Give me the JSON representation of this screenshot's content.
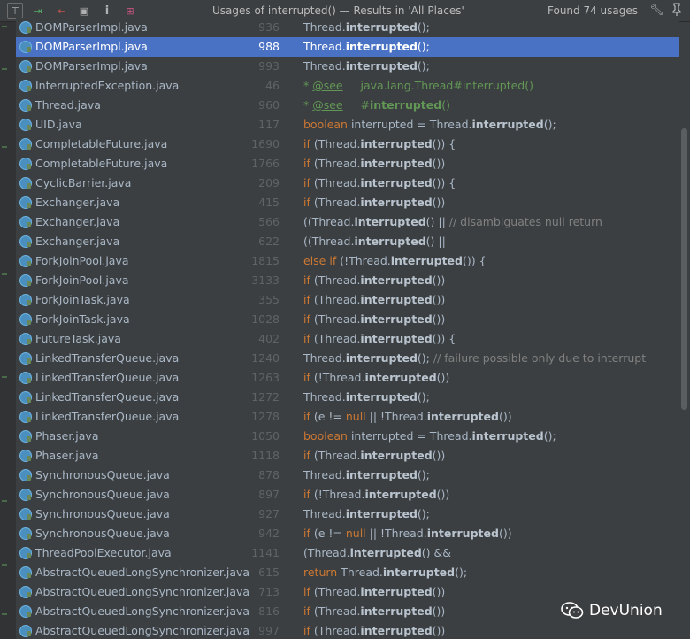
{
  "toolbar": {
    "title": "Usages of interrupted() — Results in 'All Places'",
    "count": "Found 74 usages",
    "buttons": [
      {
        "name": "merge-icon",
        "glyph": "⊤"
      },
      {
        "name": "jump-in-icon",
        "glyph": "⇥"
      },
      {
        "name": "jump-out-icon",
        "glyph": "⇤"
      },
      {
        "name": "folder-icon",
        "glyph": "▣"
      },
      {
        "name": "info-icon",
        "glyph": "i"
      },
      {
        "name": "expand-icon",
        "glyph": "⊞"
      }
    ]
  },
  "rows": [
    {
      "file": "DOMParserImpl.java",
      "line": "936",
      "code": [
        {
          "t": "Thread."
        },
        {
          "t": "interrupted",
          "b": true
        },
        {
          "t": "();"
        }
      ]
    },
    {
      "file": "DOMParserImpl.java",
      "line": "988",
      "selected": true,
      "code": [
        {
          "t": "Thread."
        },
        {
          "t": "interrupted",
          "b": true
        },
        {
          "t": "();"
        }
      ]
    },
    {
      "file": "DOMParserImpl.java",
      "line": "993",
      "code": [
        {
          "t": "Thread."
        },
        {
          "t": "interrupted",
          "b": true
        },
        {
          "t": "();"
        }
      ]
    },
    {
      "file": "InterruptedException.java",
      "line": "46",
      "code": [
        {
          "t": "* ",
          "c": "doc"
        },
        {
          "t": "@see",
          "c": "tag"
        },
        {
          "t": "     java.lang.Thread#interrupted()",
          "c": "doc"
        }
      ]
    },
    {
      "file": "Thread.java",
      "line": "960",
      "code": [
        {
          "t": "* ",
          "c": "doc"
        },
        {
          "t": "@see",
          "c": "tag"
        },
        {
          "t": "     #",
          "c": "doc"
        },
        {
          "t": "interrupted",
          "c": "doc",
          "b": true
        },
        {
          "t": "()",
          "c": "doc"
        }
      ]
    },
    {
      "file": "UID.java",
      "line": "117",
      "code": [
        {
          "t": "boolean ",
          "c": "kw"
        },
        {
          "t": "interrupted = Thread."
        },
        {
          "t": "interrupted",
          "b": true
        },
        {
          "t": "();"
        }
      ]
    },
    {
      "file": "CompletableFuture.java",
      "line": "1690",
      "code": [
        {
          "t": "if ",
          "c": "kw"
        },
        {
          "t": "(Thread."
        },
        {
          "t": "interrupted",
          "b": true
        },
        {
          "t": "()) {"
        }
      ]
    },
    {
      "file": "CompletableFuture.java",
      "line": "1766",
      "code": [
        {
          "t": "if ",
          "c": "kw"
        },
        {
          "t": "(Thread."
        },
        {
          "t": "interrupted",
          "b": true
        },
        {
          "t": "())"
        }
      ]
    },
    {
      "file": "CyclicBarrier.java",
      "line": "209",
      "code": [
        {
          "t": "if ",
          "c": "kw"
        },
        {
          "t": "(Thread."
        },
        {
          "t": "interrupted",
          "b": true
        },
        {
          "t": "()) {"
        }
      ]
    },
    {
      "file": "Exchanger.java",
      "line": "415",
      "code": [
        {
          "t": "if ",
          "c": "kw"
        },
        {
          "t": "(Thread."
        },
        {
          "t": "interrupted",
          "b": true
        },
        {
          "t": "())"
        }
      ]
    },
    {
      "file": "Exchanger.java",
      "line": "566",
      "code": [
        {
          "t": "((Thread."
        },
        {
          "t": "interrupted",
          "b": true
        },
        {
          "t": "() || "
        },
        {
          "t": "// disambiguates null return",
          "c": "cm"
        }
      ]
    },
    {
      "file": "Exchanger.java",
      "line": "622",
      "code": [
        {
          "t": "((Thread."
        },
        {
          "t": "interrupted",
          "b": true
        },
        {
          "t": "() ||"
        }
      ]
    },
    {
      "file": "ForkJoinPool.java",
      "line": "1815",
      "code": [
        {
          "t": "else if ",
          "c": "kw"
        },
        {
          "t": "(!Thread."
        },
        {
          "t": "interrupted",
          "b": true
        },
        {
          "t": "()) {"
        }
      ]
    },
    {
      "file": "ForkJoinPool.java",
      "line": "3133",
      "code": [
        {
          "t": "if ",
          "c": "kw"
        },
        {
          "t": "(Thread."
        },
        {
          "t": "interrupted",
          "b": true
        },
        {
          "t": "())"
        }
      ]
    },
    {
      "file": "ForkJoinTask.java",
      "line": "355",
      "code": [
        {
          "t": "if ",
          "c": "kw"
        },
        {
          "t": "(Thread."
        },
        {
          "t": "interrupted",
          "b": true
        },
        {
          "t": "())"
        }
      ]
    },
    {
      "file": "ForkJoinTask.java",
      "line": "1028",
      "code": [
        {
          "t": "if ",
          "c": "kw"
        },
        {
          "t": "(Thread."
        },
        {
          "t": "interrupted",
          "b": true
        },
        {
          "t": "())"
        }
      ]
    },
    {
      "file": "FutureTask.java",
      "line": "402",
      "code": [
        {
          "t": "if ",
          "c": "kw"
        },
        {
          "t": "(Thread."
        },
        {
          "t": "interrupted",
          "b": true
        },
        {
          "t": "()) {"
        }
      ]
    },
    {
      "file": "LinkedTransferQueue.java",
      "line": "1240",
      "code": [
        {
          "t": "Thread."
        },
        {
          "t": "interrupted",
          "b": true
        },
        {
          "t": "(); "
        },
        {
          "t": "// failure possible only due to interrupt",
          "c": "cm"
        }
      ]
    },
    {
      "file": "LinkedTransferQueue.java",
      "line": "1263",
      "code": [
        {
          "t": "if ",
          "c": "kw"
        },
        {
          "t": "(!Thread."
        },
        {
          "t": "interrupted",
          "b": true
        },
        {
          "t": "())"
        }
      ]
    },
    {
      "file": "LinkedTransferQueue.java",
      "line": "1272",
      "code": [
        {
          "t": "Thread."
        },
        {
          "t": "interrupted",
          "b": true
        },
        {
          "t": "();"
        }
      ]
    },
    {
      "file": "LinkedTransferQueue.java",
      "line": "1278",
      "code": [
        {
          "t": "if ",
          "c": "kw"
        },
        {
          "t": "(e != "
        },
        {
          "t": "null",
          "c": "kw"
        },
        {
          "t": " || !Thread."
        },
        {
          "t": "interrupted",
          "b": true
        },
        {
          "t": "())"
        }
      ]
    },
    {
      "file": "Phaser.java",
      "line": "1050",
      "code": [
        {
          "t": "boolean ",
          "c": "kw"
        },
        {
          "t": "interrupted = Thread."
        },
        {
          "t": "interrupted",
          "b": true
        },
        {
          "t": "();"
        }
      ]
    },
    {
      "file": "Phaser.java",
      "line": "1118",
      "code": [
        {
          "t": "if ",
          "c": "kw"
        },
        {
          "t": "(Thread."
        },
        {
          "t": "interrupted",
          "b": true
        },
        {
          "t": "())"
        }
      ]
    },
    {
      "file": "SynchronousQueue.java",
      "line": "878",
      "code": [
        {
          "t": "Thread."
        },
        {
          "t": "interrupted",
          "b": true
        },
        {
          "t": "();"
        }
      ]
    },
    {
      "file": "SynchronousQueue.java",
      "line": "897",
      "code": [
        {
          "t": "if ",
          "c": "kw"
        },
        {
          "t": "(!Thread."
        },
        {
          "t": "interrupted",
          "b": true
        },
        {
          "t": "())"
        }
      ]
    },
    {
      "file": "SynchronousQueue.java",
      "line": "927",
      "code": [
        {
          "t": "Thread."
        },
        {
          "t": "interrupted",
          "b": true
        },
        {
          "t": "();"
        }
      ]
    },
    {
      "file": "SynchronousQueue.java",
      "line": "942",
      "code": [
        {
          "t": "if ",
          "c": "kw"
        },
        {
          "t": "(e != "
        },
        {
          "t": "null",
          "c": "kw"
        },
        {
          "t": " || !Thread."
        },
        {
          "t": "interrupted",
          "b": true
        },
        {
          "t": "())"
        }
      ]
    },
    {
      "file": "ThreadPoolExecutor.java",
      "line": "1141",
      "code": [
        {
          "t": "(Thread."
        },
        {
          "t": "interrupted",
          "b": true
        },
        {
          "t": "() &&"
        }
      ]
    },
    {
      "file": "AbstractQueuedLongSynchronizer.java",
      "line": "615",
      "code": [
        {
          "t": "return ",
          "c": "kw"
        },
        {
          "t": "Thread."
        },
        {
          "t": "interrupted",
          "b": true
        },
        {
          "t": "();"
        }
      ]
    },
    {
      "file": "AbstractQueuedLongSynchronizer.java",
      "line": "713",
      "code": [
        {
          "t": "if ",
          "c": "kw"
        },
        {
          "t": "(Thread."
        },
        {
          "t": "interrupted",
          "b": true
        },
        {
          "t": "())"
        }
      ]
    },
    {
      "file": "AbstractQueuedLongSynchronizer.java",
      "line": "816",
      "code": [
        {
          "t": "if ",
          "c": "kw"
        },
        {
          "t": "(Thread."
        },
        {
          "t": "interrupted",
          "b": true
        },
        {
          "t": "())"
        }
      ]
    },
    {
      "file": "AbstractQueuedLongSynchronizer.java",
      "line": "997",
      "code": [
        {
          "t": "if ",
          "c": "kw"
        },
        {
          "t": "(Thread."
        },
        {
          "t": "interrupted",
          "b": true
        },
        {
          "t": "())"
        }
      ]
    }
  ],
  "watermark": {
    "text": "DevUnion"
  },
  "colors": {
    "selection": "#4a72c4",
    "keyword": "#cc7832",
    "comment": "#808080",
    "doc": "#629755",
    "linenumber": "#606366"
  }
}
